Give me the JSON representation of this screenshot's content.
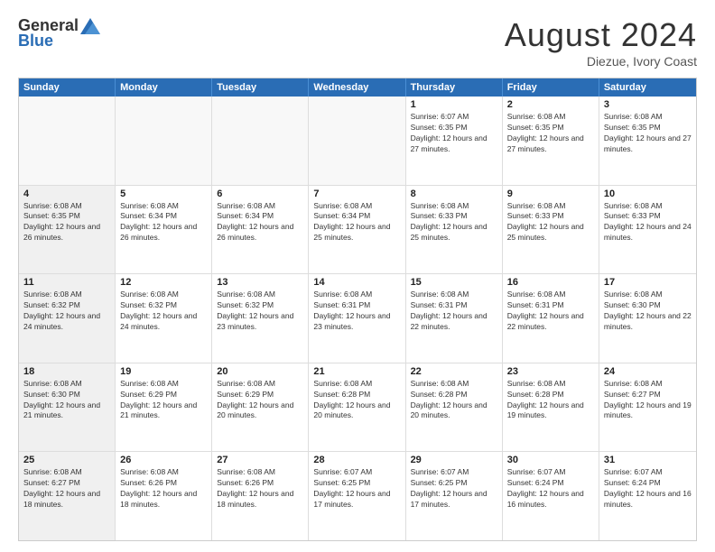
{
  "header": {
    "logo_general": "General",
    "logo_blue": "Blue",
    "month_title": "August 2024",
    "subtitle": "Diezue, Ivory Coast"
  },
  "days_of_week": [
    "Sunday",
    "Monday",
    "Tuesday",
    "Wednesday",
    "Thursday",
    "Friday",
    "Saturday"
  ],
  "weeks": [
    [
      {
        "day": "",
        "empty": true
      },
      {
        "day": "",
        "empty": true
      },
      {
        "day": "",
        "empty": true
      },
      {
        "day": "",
        "empty": true
      },
      {
        "day": "1",
        "sunrise": "6:07 AM",
        "sunset": "6:35 PM",
        "daylight": "12 hours and 27 minutes."
      },
      {
        "day": "2",
        "sunrise": "6:08 AM",
        "sunset": "6:35 PM",
        "daylight": "12 hours and 27 minutes."
      },
      {
        "day": "3",
        "sunrise": "6:08 AM",
        "sunset": "6:35 PM",
        "daylight": "12 hours and 27 minutes."
      }
    ],
    [
      {
        "day": "4",
        "sunrise": "6:08 AM",
        "sunset": "6:35 PM",
        "daylight": "12 hours and 26 minutes."
      },
      {
        "day": "5",
        "sunrise": "6:08 AM",
        "sunset": "6:34 PM",
        "daylight": "12 hours and 26 minutes."
      },
      {
        "day": "6",
        "sunrise": "6:08 AM",
        "sunset": "6:34 PM",
        "daylight": "12 hours and 26 minutes."
      },
      {
        "day": "7",
        "sunrise": "6:08 AM",
        "sunset": "6:34 PM",
        "daylight": "12 hours and 25 minutes."
      },
      {
        "day": "8",
        "sunrise": "6:08 AM",
        "sunset": "6:33 PM",
        "daylight": "12 hours and 25 minutes."
      },
      {
        "day": "9",
        "sunrise": "6:08 AM",
        "sunset": "6:33 PM",
        "daylight": "12 hours and 25 minutes."
      },
      {
        "day": "10",
        "sunrise": "6:08 AM",
        "sunset": "6:33 PM",
        "daylight": "12 hours and 24 minutes."
      }
    ],
    [
      {
        "day": "11",
        "sunrise": "6:08 AM",
        "sunset": "6:32 PM",
        "daylight": "12 hours and 24 minutes."
      },
      {
        "day": "12",
        "sunrise": "6:08 AM",
        "sunset": "6:32 PM",
        "daylight": "12 hours and 24 minutes."
      },
      {
        "day": "13",
        "sunrise": "6:08 AM",
        "sunset": "6:32 PM",
        "daylight": "12 hours and 23 minutes."
      },
      {
        "day": "14",
        "sunrise": "6:08 AM",
        "sunset": "6:31 PM",
        "daylight": "12 hours and 23 minutes."
      },
      {
        "day": "15",
        "sunrise": "6:08 AM",
        "sunset": "6:31 PM",
        "daylight": "12 hours and 22 minutes."
      },
      {
        "day": "16",
        "sunrise": "6:08 AM",
        "sunset": "6:31 PM",
        "daylight": "12 hours and 22 minutes."
      },
      {
        "day": "17",
        "sunrise": "6:08 AM",
        "sunset": "6:30 PM",
        "daylight": "12 hours and 22 minutes."
      }
    ],
    [
      {
        "day": "18",
        "sunrise": "6:08 AM",
        "sunset": "6:30 PM",
        "daylight": "12 hours and 21 minutes."
      },
      {
        "day": "19",
        "sunrise": "6:08 AM",
        "sunset": "6:29 PM",
        "daylight": "12 hours and 21 minutes."
      },
      {
        "day": "20",
        "sunrise": "6:08 AM",
        "sunset": "6:29 PM",
        "daylight": "12 hours and 20 minutes."
      },
      {
        "day": "21",
        "sunrise": "6:08 AM",
        "sunset": "6:28 PM",
        "daylight": "12 hours and 20 minutes."
      },
      {
        "day": "22",
        "sunrise": "6:08 AM",
        "sunset": "6:28 PM",
        "daylight": "12 hours and 20 minutes."
      },
      {
        "day": "23",
        "sunrise": "6:08 AM",
        "sunset": "6:28 PM",
        "daylight": "12 hours and 19 minutes."
      },
      {
        "day": "24",
        "sunrise": "6:08 AM",
        "sunset": "6:27 PM",
        "daylight": "12 hours and 19 minutes."
      }
    ],
    [
      {
        "day": "25",
        "sunrise": "6:08 AM",
        "sunset": "6:27 PM",
        "daylight": "12 hours and 18 minutes."
      },
      {
        "day": "26",
        "sunrise": "6:08 AM",
        "sunset": "6:26 PM",
        "daylight": "12 hours and 18 minutes."
      },
      {
        "day": "27",
        "sunrise": "6:08 AM",
        "sunset": "6:26 PM",
        "daylight": "12 hours and 18 minutes."
      },
      {
        "day": "28",
        "sunrise": "6:07 AM",
        "sunset": "6:25 PM",
        "daylight": "12 hours and 17 minutes."
      },
      {
        "day": "29",
        "sunrise": "6:07 AM",
        "sunset": "6:25 PM",
        "daylight": "12 hours and 17 minutes."
      },
      {
        "day": "30",
        "sunrise": "6:07 AM",
        "sunset": "6:24 PM",
        "daylight": "12 hours and 16 minutes."
      },
      {
        "day": "31",
        "sunrise": "6:07 AM",
        "sunset": "6:24 PM",
        "daylight": "12 hours and 16 minutes."
      }
    ]
  ],
  "labels": {
    "sunrise": "Sunrise:",
    "sunset": "Sunset:",
    "daylight": "Daylight:"
  }
}
